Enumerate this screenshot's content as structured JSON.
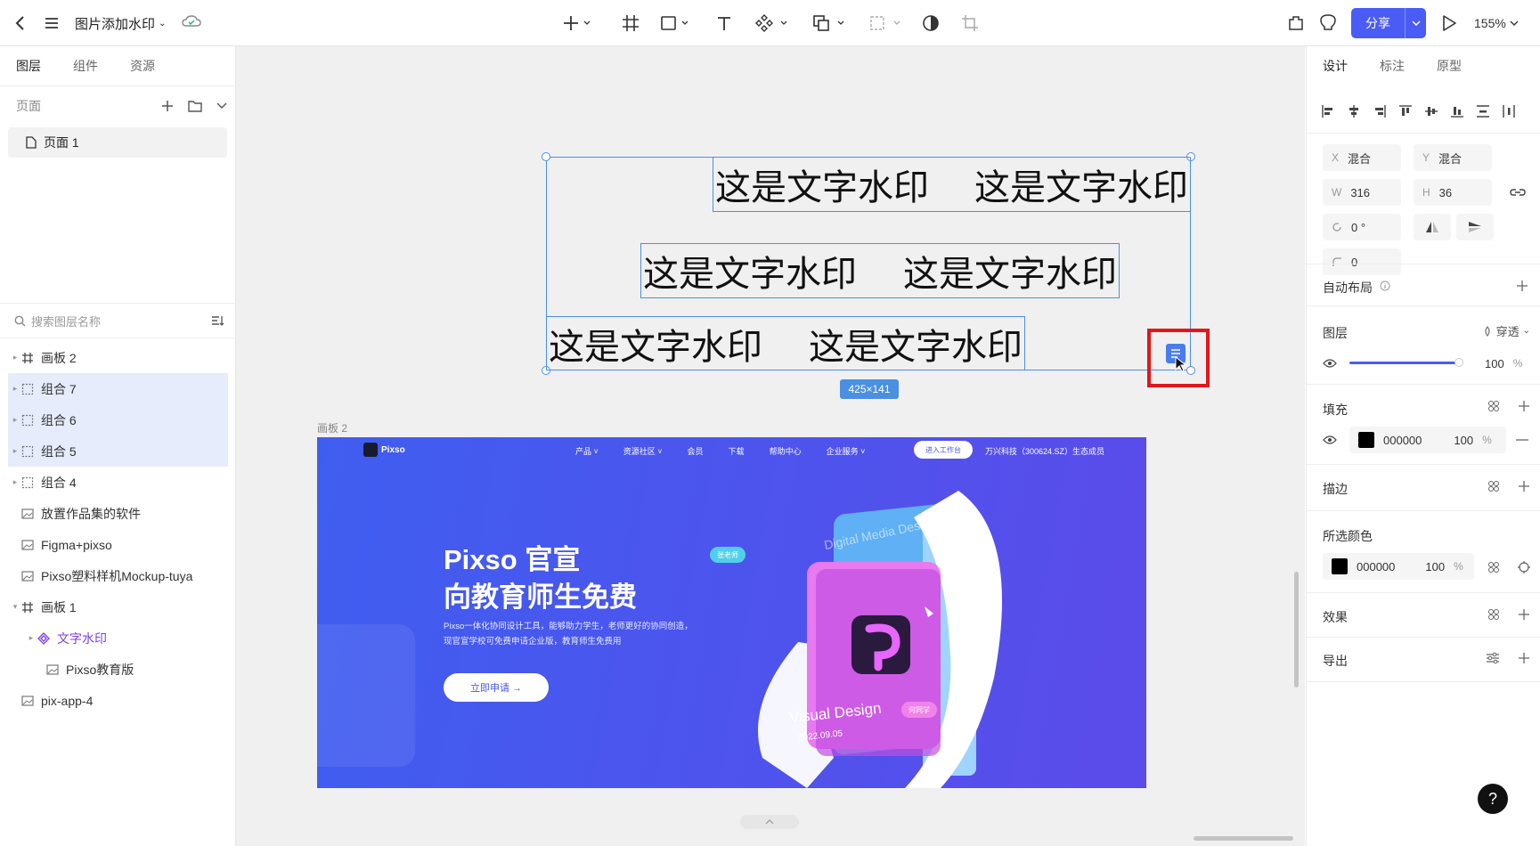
{
  "topbar": {
    "doc_title": "图片添加水印",
    "share_label": "分享",
    "zoom": "155%"
  },
  "left": {
    "tabs": [
      "图层",
      "组件",
      "资源"
    ],
    "pages_label": "页面",
    "page_item": "页面 1",
    "search_placeholder": "搜索图层名称",
    "layers": [
      {
        "name": "画板 2",
        "type": "frame",
        "expand": "▸",
        "sel": false
      },
      {
        "name": "组合 7",
        "type": "group",
        "expand": "▸",
        "sel": true
      },
      {
        "name": "组合 6",
        "type": "group",
        "expand": "▸",
        "sel": true
      },
      {
        "name": "组合 5",
        "type": "group",
        "expand": "▸",
        "sel": true
      },
      {
        "name": "组合 4",
        "type": "group",
        "expand": "▸",
        "sel": false
      },
      {
        "name": "放置作品集的软件",
        "type": "image",
        "expand": "",
        "sel": false
      },
      {
        "name": "Figma+pixso",
        "type": "image",
        "expand": "",
        "sel": false
      },
      {
        "name": "Pixso塑料样机Mockup-tuya",
        "type": "image",
        "expand": "",
        "sel": false
      },
      {
        "name": "画板 1",
        "type": "frame",
        "expand": "▾",
        "sel": false
      },
      {
        "name": "文字水印",
        "type": "component",
        "expand": "▸",
        "sel": false
      },
      {
        "name": "Pixso教育版",
        "type": "image",
        "expand": "",
        "sel": false
      },
      {
        "name": "pix-app-4",
        "type": "image",
        "expand": "",
        "sel": false
      }
    ]
  },
  "canvas": {
    "watermark_text": "这是文字水印",
    "size_label": "425×141",
    "artboard_label": "画板 2",
    "site": {
      "brand": "Pixso",
      "nav": [
        "产品 ˅",
        "资源社区 ˅",
        "会员",
        "下载",
        "帮助中心",
        "企业服务 ˅"
      ],
      "nav_button": "进入工作台",
      "nav_right": "万兴科技（300624.SZ）生态成员",
      "headline_1": "Pixso 官宣",
      "headline_2": "向教育师生免费",
      "desc_1": "Pixso一体化协同设计工具，能够助力学生，老师更好的协同创造，",
      "desc_2": "现官宣学校可免费申请企业版，教育师生免费用",
      "cta": "立即申请 →",
      "tag_1": "张老师",
      "tag_2": "何同学",
      "book_title": "Visual Design",
      "book_date": "2022.09.05",
      "book_back": "Digital Media Design"
    }
  },
  "right": {
    "tabs": [
      "设计",
      "标注",
      "原型"
    ],
    "x_key": "X",
    "x_val": "混合",
    "y_key": "Y",
    "y_val": "混合",
    "w_key": "W",
    "w_val": "316",
    "h_key": "H",
    "h_val": "36",
    "rot_val": "0 °",
    "radius_val": "0",
    "auto_layout": "自动布局",
    "layer_title": "图层",
    "blend_mode": "穿透",
    "opacity": "100",
    "pct": "%",
    "fill_title": "填充",
    "fill_hex": "000000",
    "fill_opacity": "100",
    "stroke_title": "描边",
    "selected_colors_title": "所选颜色",
    "sel_hex": "000000",
    "sel_opacity": "100",
    "effects_title": "效果",
    "export_title": "导出",
    "help": "?"
  },
  "colors": {
    "accent": "#4a5cf5",
    "selection": "#4a90e2",
    "highlight_red": "#e3161b",
    "site_bg": "#4a5cf0"
  }
}
